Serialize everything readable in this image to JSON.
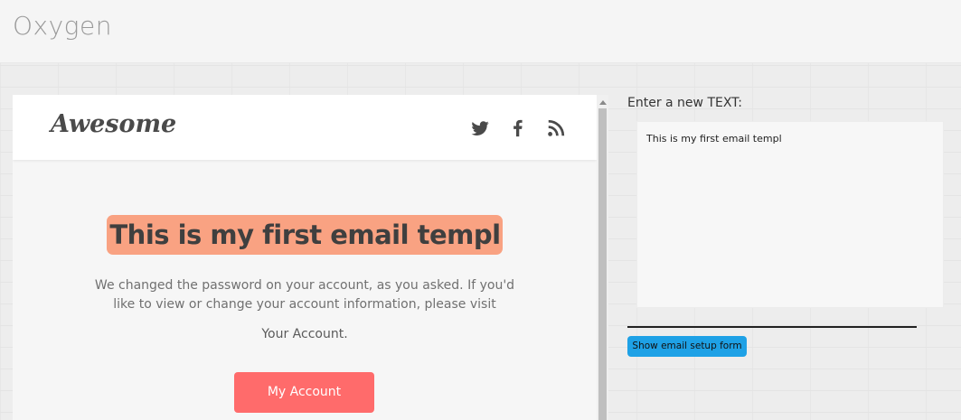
{
  "app": {
    "title": "Oxygen"
  },
  "email": {
    "brand": "Awesome",
    "social_icons": [
      "twitter-icon",
      "facebook-icon",
      "rss-icon"
    ],
    "headline": "This is my first email templ",
    "body": "We changed the password on your account, as you asked. If you'd like to view or change your account information, please visit",
    "account_text": "Your Account.",
    "button_label": "My Account"
  },
  "editor": {
    "label": "Enter a new TEXT:",
    "value": "This is my first email templ",
    "setup_button_label": "Show email setup form"
  },
  "colors": {
    "headline_highlight": "#f9a282",
    "cta_button": "#ff6b6b",
    "setup_button": "#1ea1e6"
  }
}
